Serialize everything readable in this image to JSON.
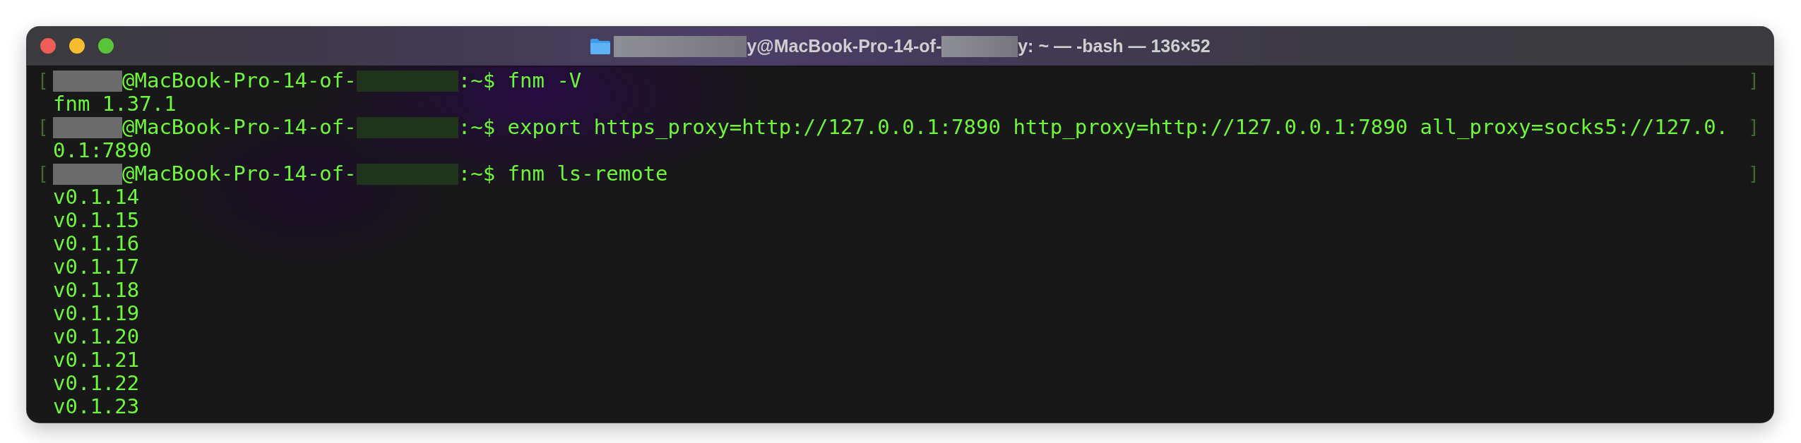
{
  "window": {
    "title_parts": [
      {
        "kind": "redacted"
      },
      {
        "kind": "text",
        "text": "y@MacBook-Pro-14-of-"
      },
      {
        "kind": "redacted"
      },
      {
        "kind": "text",
        "text": "y: ~ — -bash — 136×52"
      }
    ]
  },
  "lines": [
    {
      "start_mark": "[",
      "segments": [
        {
          "kind": "redacted",
          "color": "#6b6b6b"
        },
        {
          "kind": "text",
          "text": "@MacBook-Pro-14-of-"
        },
        {
          "kind": "redacted",
          "color": "#1f331d"
        },
        {
          "kind": "text",
          "text": ":~$ fnm -V"
        }
      ],
      "end_mark": "]"
    },
    {
      "segments": [
        {
          "kind": "text",
          "text": "fnm 1.37.1"
        }
      ]
    },
    {
      "start_mark": "[",
      "segments": [
        {
          "kind": "redacted",
          "color": "#6b6b6b"
        },
        {
          "kind": "text",
          "text": "@MacBook-Pro-14-of-"
        },
        {
          "kind": "redacted",
          "color": "#1f331d"
        },
        {
          "kind": "text",
          "text": ":~$ export https_proxy=http://127.0.0.1:7890 http_proxy=http://127.0.0.1:7890 all_proxy=socks5://127.0."
        }
      ],
      "end_mark": "]"
    },
    {
      "segments": [
        {
          "kind": "text",
          "text": "0.1:7890"
        }
      ]
    },
    {
      "start_mark": "[",
      "segments": [
        {
          "kind": "redacted",
          "color": "#6b6b6b"
        },
        {
          "kind": "text",
          "text": "@MacBook-Pro-14-of-"
        },
        {
          "kind": "redacted",
          "color": "#1f331d"
        },
        {
          "kind": "text",
          "text": ":~$ fnm ls-remote"
        }
      ],
      "end_mark": "]"
    },
    {
      "segments": [
        {
          "kind": "text",
          "text": "v0.1.14"
        }
      ]
    },
    {
      "segments": [
        {
          "kind": "text",
          "text": "v0.1.15"
        }
      ]
    },
    {
      "segments": [
        {
          "kind": "text",
          "text": "v0.1.16"
        }
      ]
    },
    {
      "segments": [
        {
          "kind": "text",
          "text": "v0.1.17"
        }
      ]
    },
    {
      "segments": [
        {
          "kind": "text",
          "text": "v0.1.18"
        }
      ]
    },
    {
      "segments": [
        {
          "kind": "text",
          "text": "v0.1.19"
        }
      ]
    },
    {
      "segments": [
        {
          "kind": "text",
          "text": "v0.1.20"
        }
      ]
    },
    {
      "segments": [
        {
          "kind": "text",
          "text": "v0.1.21"
        }
      ]
    },
    {
      "segments": [
        {
          "kind": "text",
          "text": "v0.1.22"
        }
      ]
    },
    {
      "segments": [
        {
          "kind": "text",
          "text": "v0.1.23"
        }
      ]
    }
  ]
}
